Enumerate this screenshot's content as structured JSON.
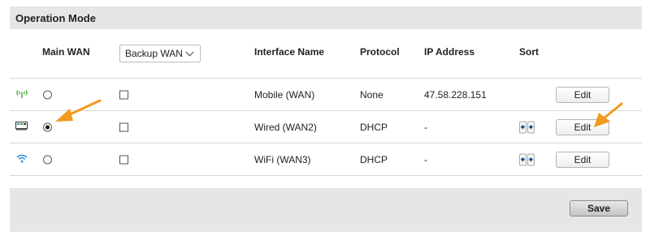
{
  "section": {
    "title": "Operation Mode"
  },
  "table": {
    "headers": {
      "main_wan": "Main WAN",
      "backup_wan": "Backup WAN",
      "interface_name": "Interface Name",
      "protocol": "Protocol",
      "ip_address": "IP Address",
      "sort": "Sort"
    },
    "rows": [
      {
        "icon": "mobile-signal-icon",
        "name": "Mobile (WAN)",
        "protocol": "None",
        "ip": "47.58.228.151",
        "main_selected": false,
        "backup_checked": false,
        "edit_label": "Edit",
        "sortable": false
      },
      {
        "icon": "ethernet-port-icon",
        "name": "Wired (WAN2)",
        "protocol": "DHCP",
        "ip": "-",
        "main_selected": true,
        "backup_checked": false,
        "edit_label": "Edit",
        "sortable": true
      },
      {
        "icon": "wifi-icon",
        "name": "WiFi (WAN3)",
        "protocol": "DHCP",
        "ip": "-",
        "main_selected": false,
        "backup_checked": false,
        "edit_label": "Edit",
        "sortable": true
      }
    ]
  },
  "footer": {
    "save_label": "Save"
  },
  "colors": {
    "header_bg": "#e6e6e6",
    "annotation_arrow": "#f39a1f",
    "mobile_icon": "#3aa935",
    "wifi_icon": "#2a8fd6"
  }
}
